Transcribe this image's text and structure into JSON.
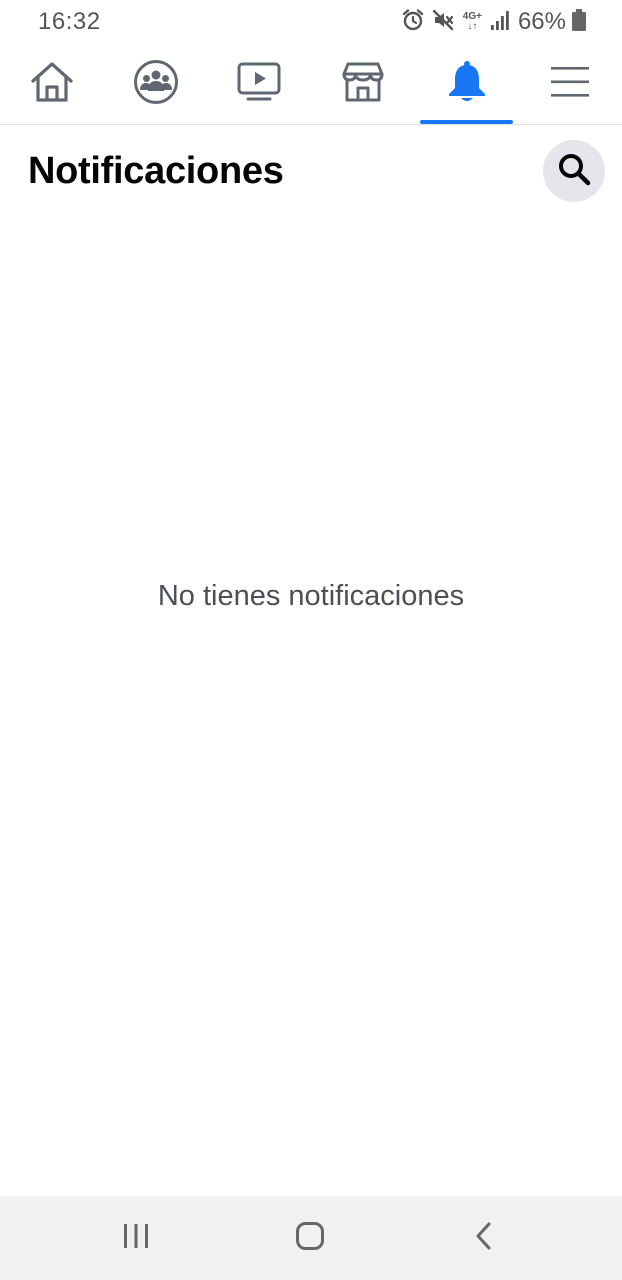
{
  "status_bar": {
    "time": "16:32",
    "network": "4G+",
    "battery": "66%",
    "icons": [
      "alarm-icon",
      "mute-icon",
      "network-4g-icon",
      "signal-icon",
      "battery-icon"
    ]
  },
  "nav": {
    "active_tab": "notifications",
    "accent_color": "#1877f2",
    "tabs": [
      {
        "id": "home",
        "icon": "home-icon"
      },
      {
        "id": "groups",
        "icon": "groups-icon"
      },
      {
        "id": "watch",
        "icon": "video-icon"
      },
      {
        "id": "marketplace",
        "icon": "marketplace-icon"
      },
      {
        "id": "notifications",
        "icon": "bell-icon"
      },
      {
        "id": "menu",
        "icon": "menu-icon"
      }
    ]
  },
  "header": {
    "title": "Notificaciones",
    "search_icon": "search-icon"
  },
  "main": {
    "empty_message": "No tienes notificaciones"
  },
  "system_nav": {
    "buttons": [
      "recents-icon",
      "home-circle-icon",
      "back-icon"
    ]
  }
}
